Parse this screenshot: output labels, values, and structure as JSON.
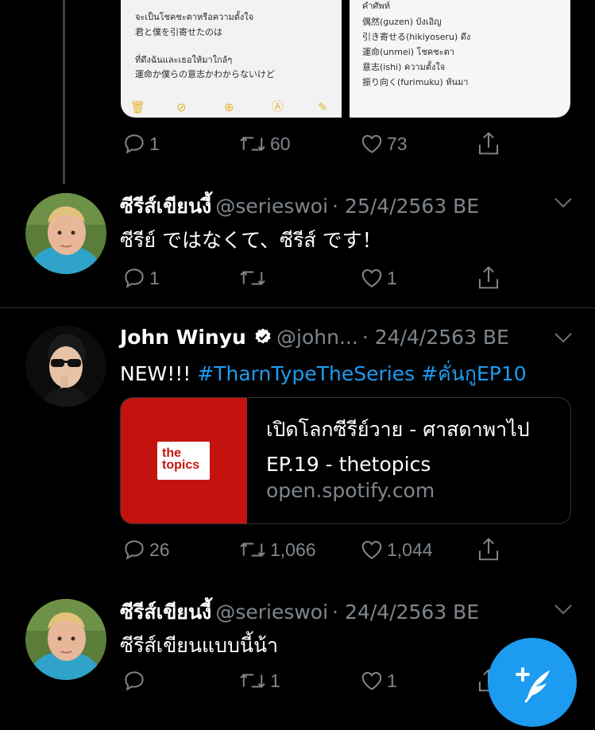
{
  "images": {
    "left_lines": [
      "จะเป็นโชคชะตาหรือความตั้งใจ",
      "君と僕を引寄せたのは",
      "",
      "ที่ดึงฉันและเธอให้มาใกล้ๆ",
      "運命か僕らの意志かわからないけど"
    ],
    "right_lines": [
      "คำศัพท์",
      "偶然(guzen) บังเอิญ",
      "引き寄せる(hikiyoseru) ดึง",
      "運命(unmei) โชคชะตา",
      "意志(ishi) ความตั้งใจ",
      "振り向く(furimuku) หันมา"
    ]
  },
  "tweet0": {
    "reply_count": "1",
    "retweet_count": "60",
    "like_count": "73"
  },
  "tweet1": {
    "name": "ซีรีส์เขียนงี้",
    "handle": "@serieswoi",
    "date": "· 25/4/2563 BE",
    "text": "ซีรีย์ ではなくて、ซีรีส์ です！",
    "reply_count": "1",
    "retweet_count": "",
    "like_count": "1"
  },
  "tweet2": {
    "name": "John Winyu",
    "handle": "@john...",
    "date": "· 24/4/2563 BE",
    "text_prefix": "NEW!!!",
    "hashtag1": "#TharnTypeTheSeries",
    "hashtag2": "#คั่นกูEP10",
    "card": {
      "logo_line1": "the",
      "logo_line2": "topics",
      "title": "เปิดโลกซีรีย์วาย - ศาสดาพาไป EP.19 - thetopics",
      "domain": "open.spotify.com"
    },
    "reply_count": "26",
    "retweet_count": "1,066",
    "like_count": "1,044"
  },
  "tweet3": {
    "name": "ซีรีส์เขียนงี้",
    "handle": "@serieswoi",
    "date": "· 24/4/2563 BE",
    "text": "ซีรีส์เขียนแบบนี้น้า",
    "reply_count": "",
    "retweet_count": "1",
    "like_count": "1"
  },
  "colors": {
    "accent": "#1d9bf0",
    "muted": "#7f868c",
    "background": "#000000",
    "verified": "#ffffff"
  }
}
